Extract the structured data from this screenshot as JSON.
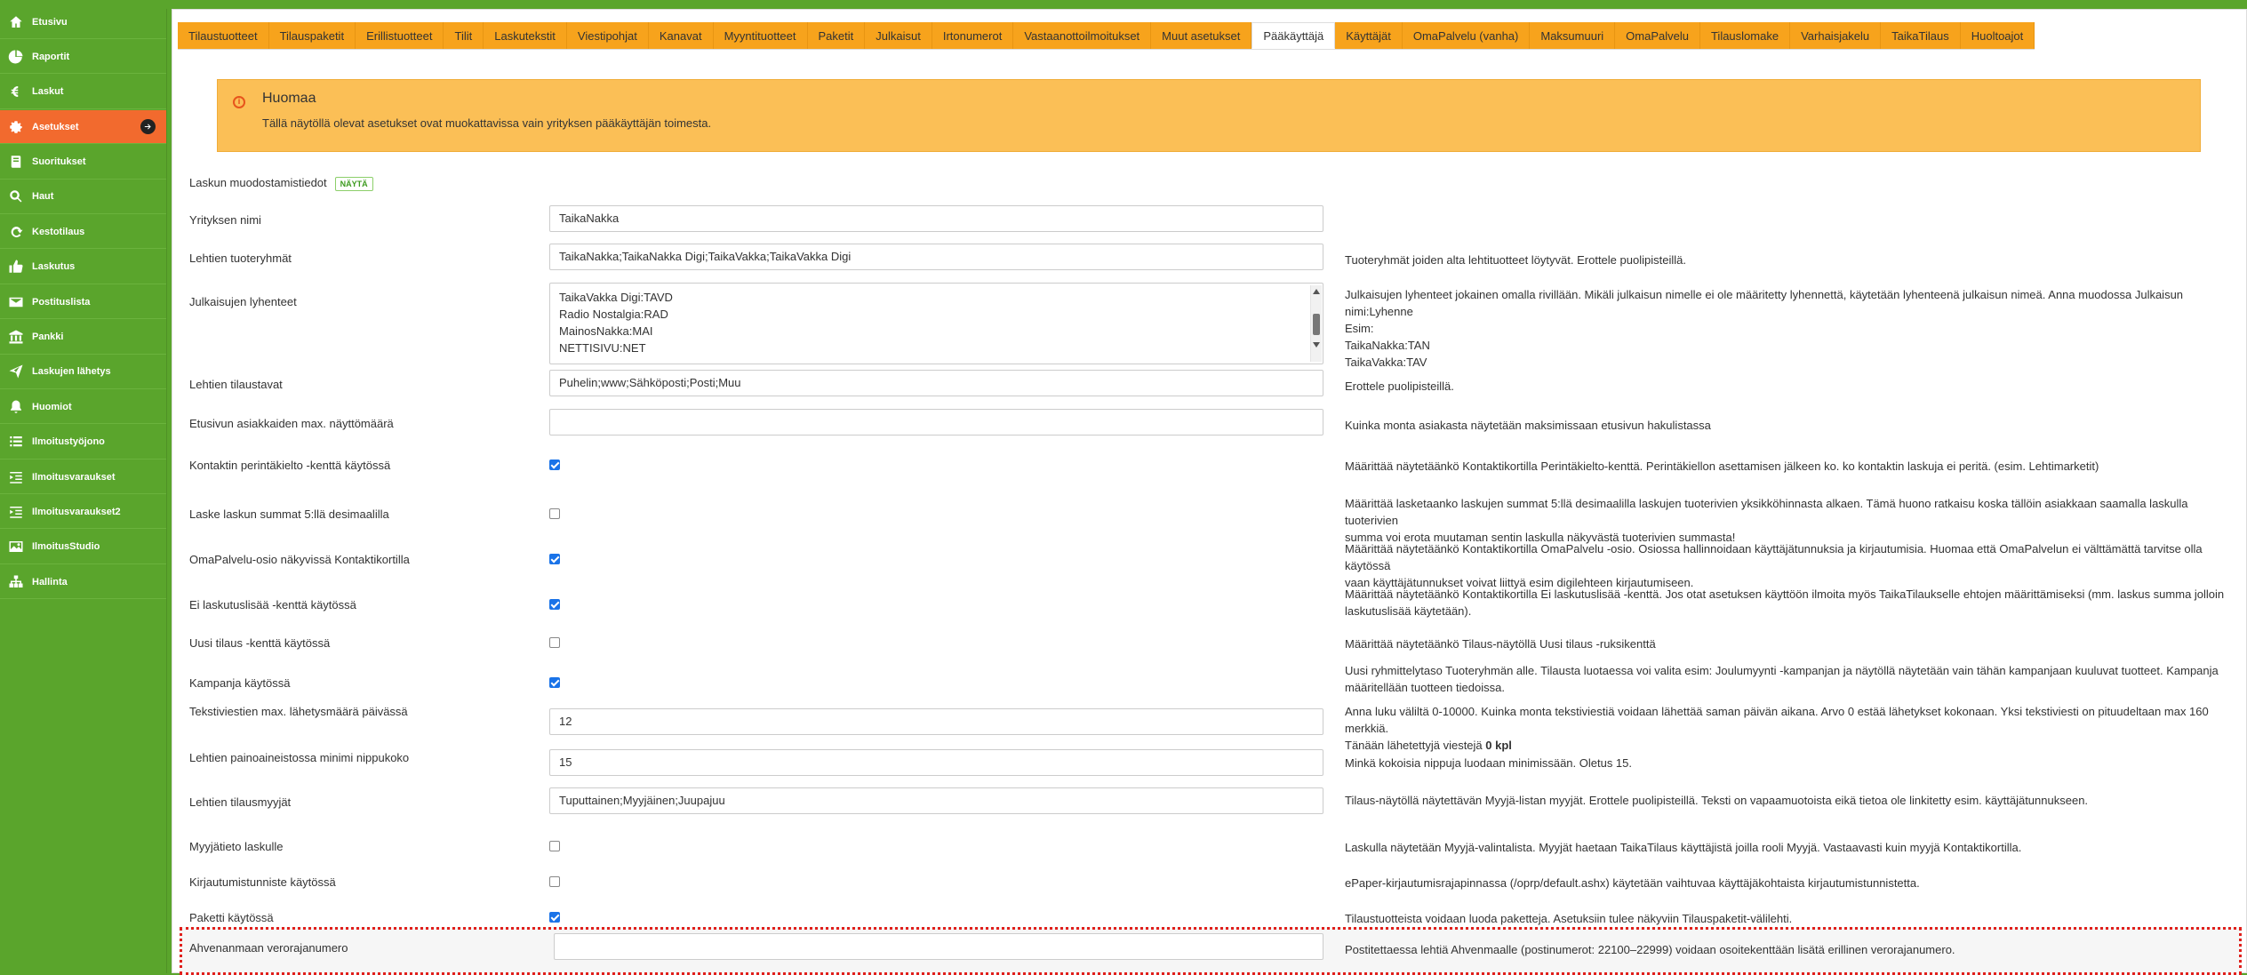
{
  "sidebar": {
    "items": [
      {
        "label": "Etusivu",
        "icon": "home-icon",
        "active": false
      },
      {
        "label": "Raportit",
        "icon": "pie-chart-icon",
        "active": false
      },
      {
        "label": "Laskut",
        "icon": "euro-icon",
        "active": false
      },
      {
        "label": "Asetukset",
        "icon": "gear-icon",
        "active": true
      },
      {
        "label": "Suoritukset",
        "icon": "book-icon",
        "active": false
      },
      {
        "label": "Haut",
        "icon": "search-icon",
        "active": false
      },
      {
        "label": "Kestotilaus",
        "icon": "refresh-icon",
        "active": false
      },
      {
        "label": "Laskutus",
        "icon": "thumbs-up-icon",
        "active": false
      },
      {
        "label": "Postituslista",
        "icon": "envelope-icon",
        "active": false
      },
      {
        "label": "Pankki",
        "icon": "bank-icon",
        "active": false
      },
      {
        "label": "Laskujen lähetys",
        "icon": "paper-plane-icon",
        "active": false
      },
      {
        "label": "Huomiot",
        "icon": "bell-icon",
        "active": false
      },
      {
        "label": "Ilmoitustyöjono",
        "icon": "list-icon",
        "active": false
      },
      {
        "label": "Ilmoitusvaraukset",
        "icon": "list-indent-icon",
        "active": false
      },
      {
        "label": "Ilmoitusvaraukset2",
        "icon": "list-indent-icon",
        "active": false
      },
      {
        "label": "IlmoitusStudio",
        "icon": "image-icon",
        "active": false
      },
      {
        "label": "Hallinta",
        "icon": "sitemap-icon",
        "active": false
      }
    ]
  },
  "tabs": [
    {
      "label": "Tilaustuotteet",
      "active": false
    },
    {
      "label": "Tilauspaketit",
      "active": false
    },
    {
      "label": "Erillistuotteet",
      "active": false
    },
    {
      "label": "Tilit",
      "active": false
    },
    {
      "label": "Laskutekstit",
      "active": false
    },
    {
      "label": "Viestipohjat",
      "active": false
    },
    {
      "label": "Kanavat",
      "active": false
    },
    {
      "label": "Myyntituotteet",
      "active": false
    },
    {
      "label": "Paketit",
      "active": false
    },
    {
      "label": "Julkaisut",
      "active": false
    },
    {
      "label": "Irtonumerot",
      "active": false
    },
    {
      "label": "Vastaanottoilmoitukset",
      "active": false
    },
    {
      "label": "Muut asetukset",
      "active": false
    },
    {
      "label": "Pääkäyttäjä",
      "active": true
    },
    {
      "label": "Käyttäjät",
      "active": false
    },
    {
      "label": "OmaPalvelu (vanha)",
      "active": false
    },
    {
      "label": "Maksumuuri",
      "active": false
    },
    {
      "label": "OmaPalvelu",
      "active": false
    },
    {
      "label": "Tilauslomake",
      "active": false
    },
    {
      "label": "Varhaisjakelu",
      "active": false
    },
    {
      "label": "TaikaTilaus",
      "active": false
    },
    {
      "label": "Huoltoajot",
      "active": false
    }
  ],
  "alert": {
    "title": "Huomaa",
    "text": "Tällä näytöllä olevat asetukset ovat muokattavissa vain yrityksen pääkäyttäjän toimesta.",
    "icon": "info-circle-icon"
  },
  "section": {
    "label": "Laskun muodostamistiedot",
    "badge": "NÄYTÄ"
  },
  "fields": {
    "yrityksen_nimi": {
      "label": "Yrityksen nimi",
      "value": "TaikaNakka"
    },
    "tuoteryhmat": {
      "label": "Lehtien tuoteryhmät",
      "value": "TaikaNakka;TaikaNakka Digi;TaikaVakka;TaikaVakka Digi",
      "help": "Tuoteryhmät joiden alta lehtituotteet löytyvät. Erottele puolipisteillä."
    },
    "lyhenteet": {
      "label": "Julkaisujen lyhenteet",
      "lines": [
        "TaikaVakka Digi:TAVD",
        "Radio Nostalgia:RAD",
        "MainosNakka:MAI",
        "NETTISIVU:NET"
      ],
      "help_lines": [
        "Julkaisujen lyhenteet jokainen omalla rivillään. Mikäli julkaisun nimelle ei ole määritetty lyhennettä, käytetään lyhenteenä julkaisun nimeä. Anna muodossa Julkaisun nimi:Lyhenne",
        "Esim:",
        "TaikaNakka:TAN",
        "TaikaVakka:TAV"
      ]
    },
    "tilaustavat": {
      "label": "Lehtien tilaustavat",
      "value": "Puhelin;www;Sähköposti;Posti;Muu",
      "help": "Erottele puolipisteillä."
    },
    "naytto": {
      "label": "Etusivun asiakkaiden max. näyttömäärä",
      "value": "",
      "help": "Kuinka monta asiakasta näytetään maksimissaan etusivun hakulistassa"
    },
    "perintakielto": {
      "label": "Kontaktin perintäkielto -kenttä käytössä",
      "checked": true,
      "help": "Määrittää näytetäänkö Kontaktikortilla Perintäkielto-kenttä. Perintäkiellon asettamisen jälkeen ko. ko kontaktin laskuja ei peritä. (esim. Lehtimarketit)"
    },
    "desimaali": {
      "label": "Laske laskun summat 5:llä desimaalilla",
      "checked": false,
      "help_lines": [
        "Määrittää lasketaanko laskujen summat 5:llä desimaalilla laskujen tuoterivien yksikköhinnasta alkaen. Tämä huono ratkaisu koska tällöin asiakkaan saamalla laskulla tuoterivien",
        "summa voi erota muutaman sentin laskulla näkyvästä tuoterivien summasta!"
      ]
    },
    "omapalvelu": {
      "label": "OmaPalvelu-osio näkyvissä Kontaktikortilla",
      "checked": true,
      "help_lines": [
        "Määrittää näytetäänkö Kontaktikortilla OmaPalvelu -osio. Osiossa hallinnoidaan käyttäjätunnuksia ja kirjautumisia. Huomaa että OmaPalvelun ei välttämättä tarvitse olla käytössä",
        "vaan käyttäjätunnukset voivat liittyä esim digilehteen kirjautumiseen."
      ]
    },
    "eilaskutuslisaa": {
      "label": "Ei laskutuslisää -kenttä käytössä",
      "checked": true,
      "help_lines": [
        "Määrittää näytetäänkö Kontaktikortilla Ei laskutuslisää -kenttä. Jos otat asetuksen käyttöön ilmoita myös TaikaTilaukselle ehtojen määrittämiseksi (mm. laskus summa jolloin",
        "laskutuslisää käytetään)."
      ]
    },
    "uusitilaus": {
      "label": "Uusi tilaus -kenttä käytössä",
      "checked": false,
      "help": "Määrittää näytetäänkö Tilaus-näytöllä Uusi tilaus -ruksikenttä"
    },
    "kampanja": {
      "label": "Kampanja käytössä",
      "checked": true,
      "help_lines": [
        "Uusi ryhmittelytaso Tuoteryhmän alle. Tilausta luotaessa voi valita esim: Joulumyynti -kampanjan ja näytöllä näytetään vain tähän kampanjaan kuuluvat tuotteet. Kampanja",
        "määritellään tuotteen tiedoissa."
      ]
    },
    "tekstiviestit": {
      "label": "Tekstiviestien max. lähetysmäärä päivässä",
      "value": "12",
      "help_lines": [
        "Anna luku väliltä 0-10000. Kuinka monta tekstiviestiä voidaan lähettää saman päivän aikana. Arvo 0 estää lähetykset kokonaan. Yksi tekstiviesti on pituudeltaan max 160 merkkiä.",
        "Tänään lähetettyjä viestejä "
      ],
      "sent_today": "0 kpl"
    },
    "nippukoko": {
      "label": "Lehtien painoaineistossa minimi nippukoko",
      "value": "15",
      "help": "Minkä kokoisia nippuja luodaan minimissään. Oletus 15."
    },
    "myyjat": {
      "label": "Lehtien tilausmyyjät",
      "value": "Tuputtainen;Myyjäinen;Juupajuu",
      "help": "Tilaus-näytöllä näytettävän Myyjä-listan myyjät. Erottele puolipisteillä. Teksti on vapaamuotoista eikä tietoa ole linkitetty esim. käyttäjätunnukseen."
    },
    "myyjatieto": {
      "label": "Myyjätieto laskulle",
      "checked": false,
      "help": "Laskulla näytetään Myyjä-valintalista. Myyjät haetaan TaikaTilaus käyttäjistä joilla rooli Myyjä. Vastaavasti kuin myyjä Kontaktikortilla."
    },
    "kirjautumistunniste": {
      "label": "Kirjautumistunniste käytössä",
      "checked": false,
      "help": "ePaper-kirjautumisrajapinnassa (/oprp/default.ashx) käytetään vaihtuvaa käyttäjäkohtaista kirjautumistunnistetta."
    },
    "paketti": {
      "label": "Paketti käytössä",
      "checked": true,
      "help": "Tilaustuotteista voidaan luoda paketteja. Asetuksiin tulee näkyviin Tilauspaketit-välilehti."
    },
    "verorajanumero": {
      "label": "Ahvenanmaan verorajanumero",
      "value": "",
      "help": "Postitettaessa lehtiä Ahvenmaalle (postinumerot: 22100–22999) voidaan osoitekenttään lisätä erillinen verorajanumero."
    }
  }
}
